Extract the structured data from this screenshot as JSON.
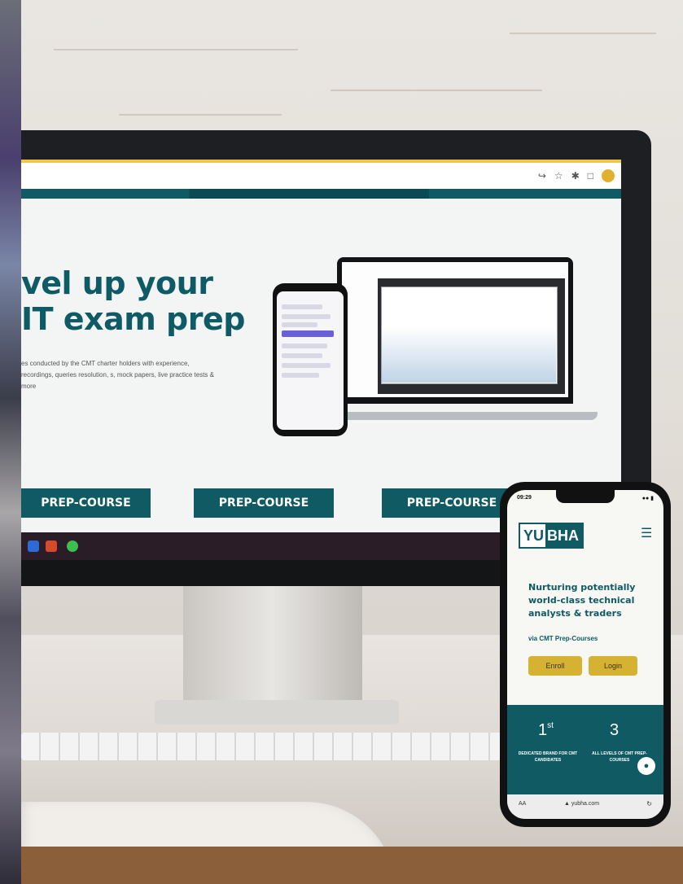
{
  "browser": {
    "icons": [
      "share-icon",
      "star-icon",
      "extensions-icon",
      "sidebar-icon",
      "profile-avatar"
    ]
  },
  "website": {
    "hero_title": "vel up your\nIT exam prep",
    "hero_description": "es conducted by the CMT charter holders with experience, recordings, queries resolution, s, mock papers, live practice tests & more",
    "prep_buttons": [
      "PREP-COURSE",
      "PREP-COURSE",
      "PREP-COURSE"
    ],
    "accent_color": "#0f5a63"
  },
  "mobile": {
    "status_time": "09:29",
    "logo_part1": "YU",
    "logo_part2": "BHA",
    "tagline": "Nurturing potentially world-class technical analysts & traders",
    "via": "via CMT Prep-Courses",
    "enroll_label": "Enroll",
    "login_label": "Login",
    "stat1_num": "1",
    "stat1_sup": "st",
    "stat1_caption": "DEDICATED BRAND FOR CMT CANDIDATES",
    "stat2_num": "3",
    "stat2_caption": "ALL LEVELS OF CMT PREP-COURSES",
    "url_aa": "AA",
    "url": "▲ yubha.com",
    "button_color": "#d6b232"
  }
}
